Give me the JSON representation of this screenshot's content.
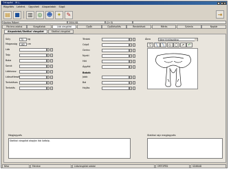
{
  "window": {
    "title": "Ortopéd - M.L."
  },
  "menu": [
    "Rögzítés",
    "Lekérd.",
    "Ügyviteli",
    "Alapadatok",
    "Súgó"
  ],
  "toolbar": {
    "icons": [
      "open-icon",
      "save-icon",
      "print-icon",
      "search-icon",
      "patient-icon",
      "settings-icon",
      "help-icon"
    ],
    "exit_icon": "exit-icon"
  },
  "status_row": [
    "Kovács Róbert",
    "2004.08.",
    "(2+3)"
  ],
  "main_tabs": [
    "Páciens adatai",
    "Vizsgálatok",
    "Láb vizsgálat",
    "Cipők",
    "Cipőkészítés",
    "Rendelések",
    "Mérés",
    "Számla",
    "Naptár"
  ],
  "sub_tabs": [
    "Alapadatok/Statikai vizsgálat",
    "Statikai vizsgálat"
  ],
  "left_fields": [
    {
      "label": "Súly",
      "value": "75",
      "unit": "kg"
    },
    {
      "label": "Magasság",
      "value": "182",
      "unit": "cm"
    },
    {
      "label": "Láb",
      "value": ""
    },
    {
      "label": "Talp",
      "value": ""
    },
    {
      "label": "Boka",
      "value": ""
    },
    {
      "label": "Sarok",
      "value": ""
    },
    {
      "label": "Lábhossz",
      "value": ""
    },
    {
      "label": "Lábszélesség",
      "value": ""
    },
    {
      "label": "Terheléses",
      "value": ""
    },
    {
      "label": "Terhelés",
      "value": ""
    }
  ],
  "mid_fields": [
    {
      "label": "Térdek",
      "value": ""
    },
    {
      "label": "Csípő",
      "value": ""
    },
    {
      "label": "Gerinc",
      "value": ""
    },
    {
      "label": "Nyaki",
      "value": ""
    },
    {
      "label": "Hát",
      "value": ""
    },
    {
      "label": "Ágyéki",
      "value": ""
    }
  ],
  "mid_section": "Bokák",
  "mid_fields2": [
    {
      "label": "Jobb",
      "value": ""
    },
    {
      "label": "Bal",
      "value": ""
    },
    {
      "label": "Hajlás",
      "value": ""
    }
  ],
  "right": {
    "label": "Ábra",
    "select_value": "ábra kiválasztása",
    "tools": [
      "pointer-icon",
      "line-icon",
      "pen-icon",
      "eraser-icon",
      "shape-icon",
      "arrow-icon",
      "undo-icon"
    ]
  },
  "bottom_left": {
    "label": "Megjegyzés",
    "value": "Statikai vizsgálat alapján láb lúdtalp."
  },
  "bottom_right": {
    "label": "Statikai rajz megjegyzés",
    "value": ""
  },
  "statusbar": [
    "Kész",
    "Mentve",
    "Lábvizsgálat adatai",
    "ORTOPÉD",
    "SZABAD"
  ],
  "colors": {
    "titlebar": "#0a246a",
    "window_bg": "#d8d2c6",
    "panel_bg": "#e9e5dd",
    "input_bg": "#ffffff"
  }
}
